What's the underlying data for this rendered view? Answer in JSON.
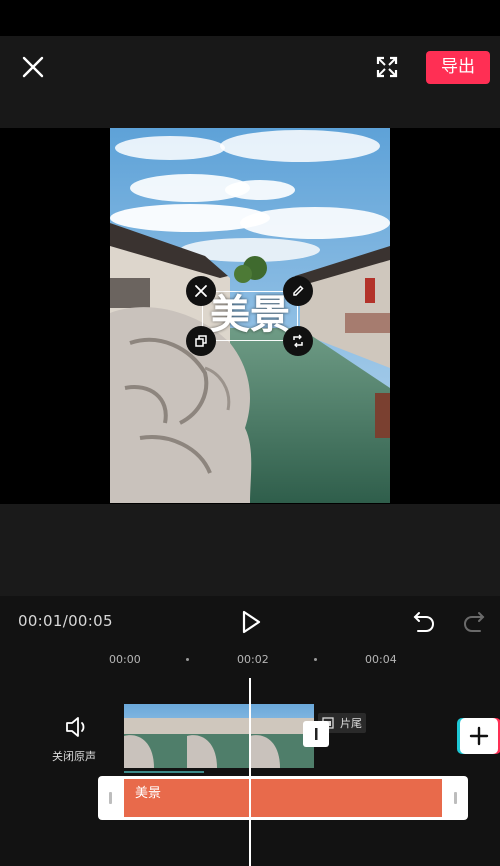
{
  "header": {
    "export_label": "导出"
  },
  "preview": {
    "overlay_text": "美景"
  },
  "playback": {
    "time_display": "00:01/00:05"
  },
  "timeline": {
    "ruler": [
      "00:00",
      "00:02",
      "00:04"
    ],
    "mute_label": "关闭原声",
    "tail_label": "片尾",
    "text_track_label": "美景"
  },
  "colors": {
    "export_accent": "#ff2f54",
    "text_track": "#e86a4b",
    "playhead": "#ffffff"
  },
  "icons": [
    "close-icon",
    "fullscreen-icon",
    "delete-icon",
    "edit-icon",
    "copy-icon",
    "rotate-icon",
    "play-icon",
    "undo-icon",
    "redo-icon",
    "speaker-icon",
    "plus-icon"
  ]
}
